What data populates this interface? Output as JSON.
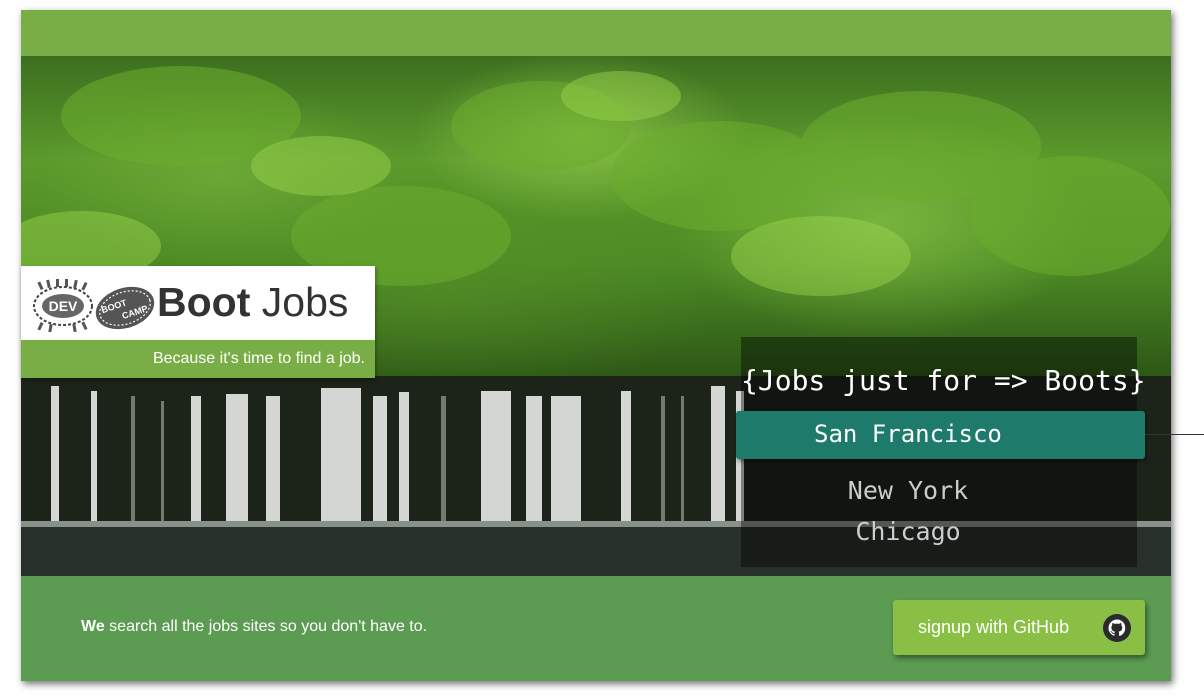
{
  "brand": {
    "name_bold": "Boot",
    "name_light": "Jobs",
    "slogan": "Because it's time to find a job.",
    "logo_text_dev": "DEV",
    "logo_text_boot": "BOOT",
    "logo_text_camp": "CAMP"
  },
  "hero": {
    "code_title": "{Jobs just for => Boots}",
    "cities": [
      {
        "label": "San Francisco",
        "selected": true
      },
      {
        "label": "New York",
        "selected": false
      },
      {
        "label": "Chicago",
        "selected": false
      }
    ]
  },
  "footer": {
    "tagline_bold": "We",
    "tagline_rest": " search all the jobs sites so you don't have to.",
    "signup_label": "signup with GitHub",
    "signup_icon": "github-icon"
  },
  "colors": {
    "topbar": "#78ae45",
    "footer": "#5c9c52",
    "button": "#8abf45",
    "selected_city": "#1e7a6a"
  }
}
